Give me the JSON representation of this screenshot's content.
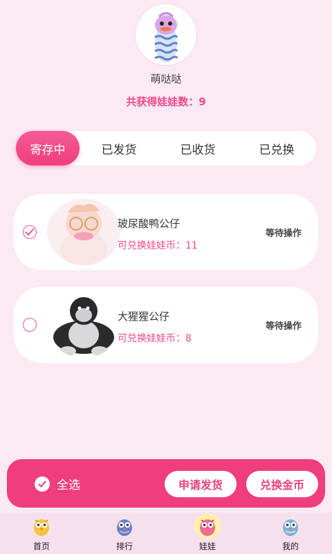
{
  "profile": {
    "nickname": "萌哒哒",
    "doll_count_text": "共获得娃娃数：9"
  },
  "tabs": [
    {
      "label": "寄存中",
      "active": true
    },
    {
      "label": "已发货",
      "active": false
    },
    {
      "label": "已收货",
      "active": false
    },
    {
      "label": "已兑换",
      "active": false
    }
  ],
  "items": [
    {
      "name": "玻尿酸鸭公仔",
      "coin_text": "可兑换娃娃币：11",
      "status": "等待操作",
      "checked": true
    },
    {
      "name": "大猩猩公仔",
      "coin_text": "可兑换娃娃币：8",
      "status": "等待操作",
      "checked": false
    }
  ],
  "actions": {
    "select_all": "全选",
    "ship": "申请发货",
    "exchange": "兑换金币"
  },
  "nav": [
    {
      "label": "首页",
      "icon": "owl-yellow-icon"
    },
    {
      "label": "排行",
      "icon": "owl-blue-icon"
    },
    {
      "label": "娃娃",
      "icon": "owl-pink-icon",
      "active": true
    },
    {
      "label": "我的",
      "icon": "owl-lightblue-icon"
    }
  ],
  "colors": {
    "accent": "#f03d7d",
    "background": "#fbe9f4"
  }
}
